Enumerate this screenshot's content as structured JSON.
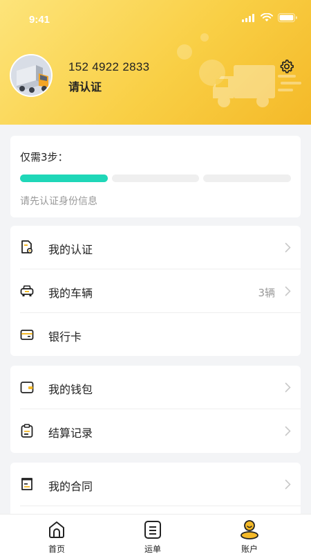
{
  "status_bar": {
    "time": "9:41"
  },
  "profile": {
    "phone": "152 4922 2833",
    "verify_text": "请认证"
  },
  "steps": {
    "title": "仅需3步：",
    "completed": 1,
    "total": 3,
    "hint": "请先认证身份信息"
  },
  "menu": {
    "certification": {
      "label": "我的认证",
      "icon": "certificate-icon"
    },
    "vehicles": {
      "label": "我的车辆",
      "count": "3辆",
      "icon": "car-icon"
    },
    "bank_card": {
      "label": "银行卡",
      "icon": "bank-card-icon"
    },
    "wallet": {
      "label": "我的钱包",
      "icon": "wallet-icon"
    },
    "settlement": {
      "label": "结算记录",
      "icon": "clipboard-icon"
    },
    "contract": {
      "label": "我的合同",
      "icon": "contract-icon"
    }
  },
  "tabbar": {
    "home": {
      "label": "首页",
      "icon": "home-icon"
    },
    "waybill": {
      "label": "运单",
      "icon": "waybill-icon"
    },
    "account": {
      "label": "账户",
      "icon": "account-icon",
      "active": true
    }
  },
  "colors": {
    "header": "#f9cf45",
    "progress": "#1fd7b8",
    "accent": "#f4b928"
  }
}
